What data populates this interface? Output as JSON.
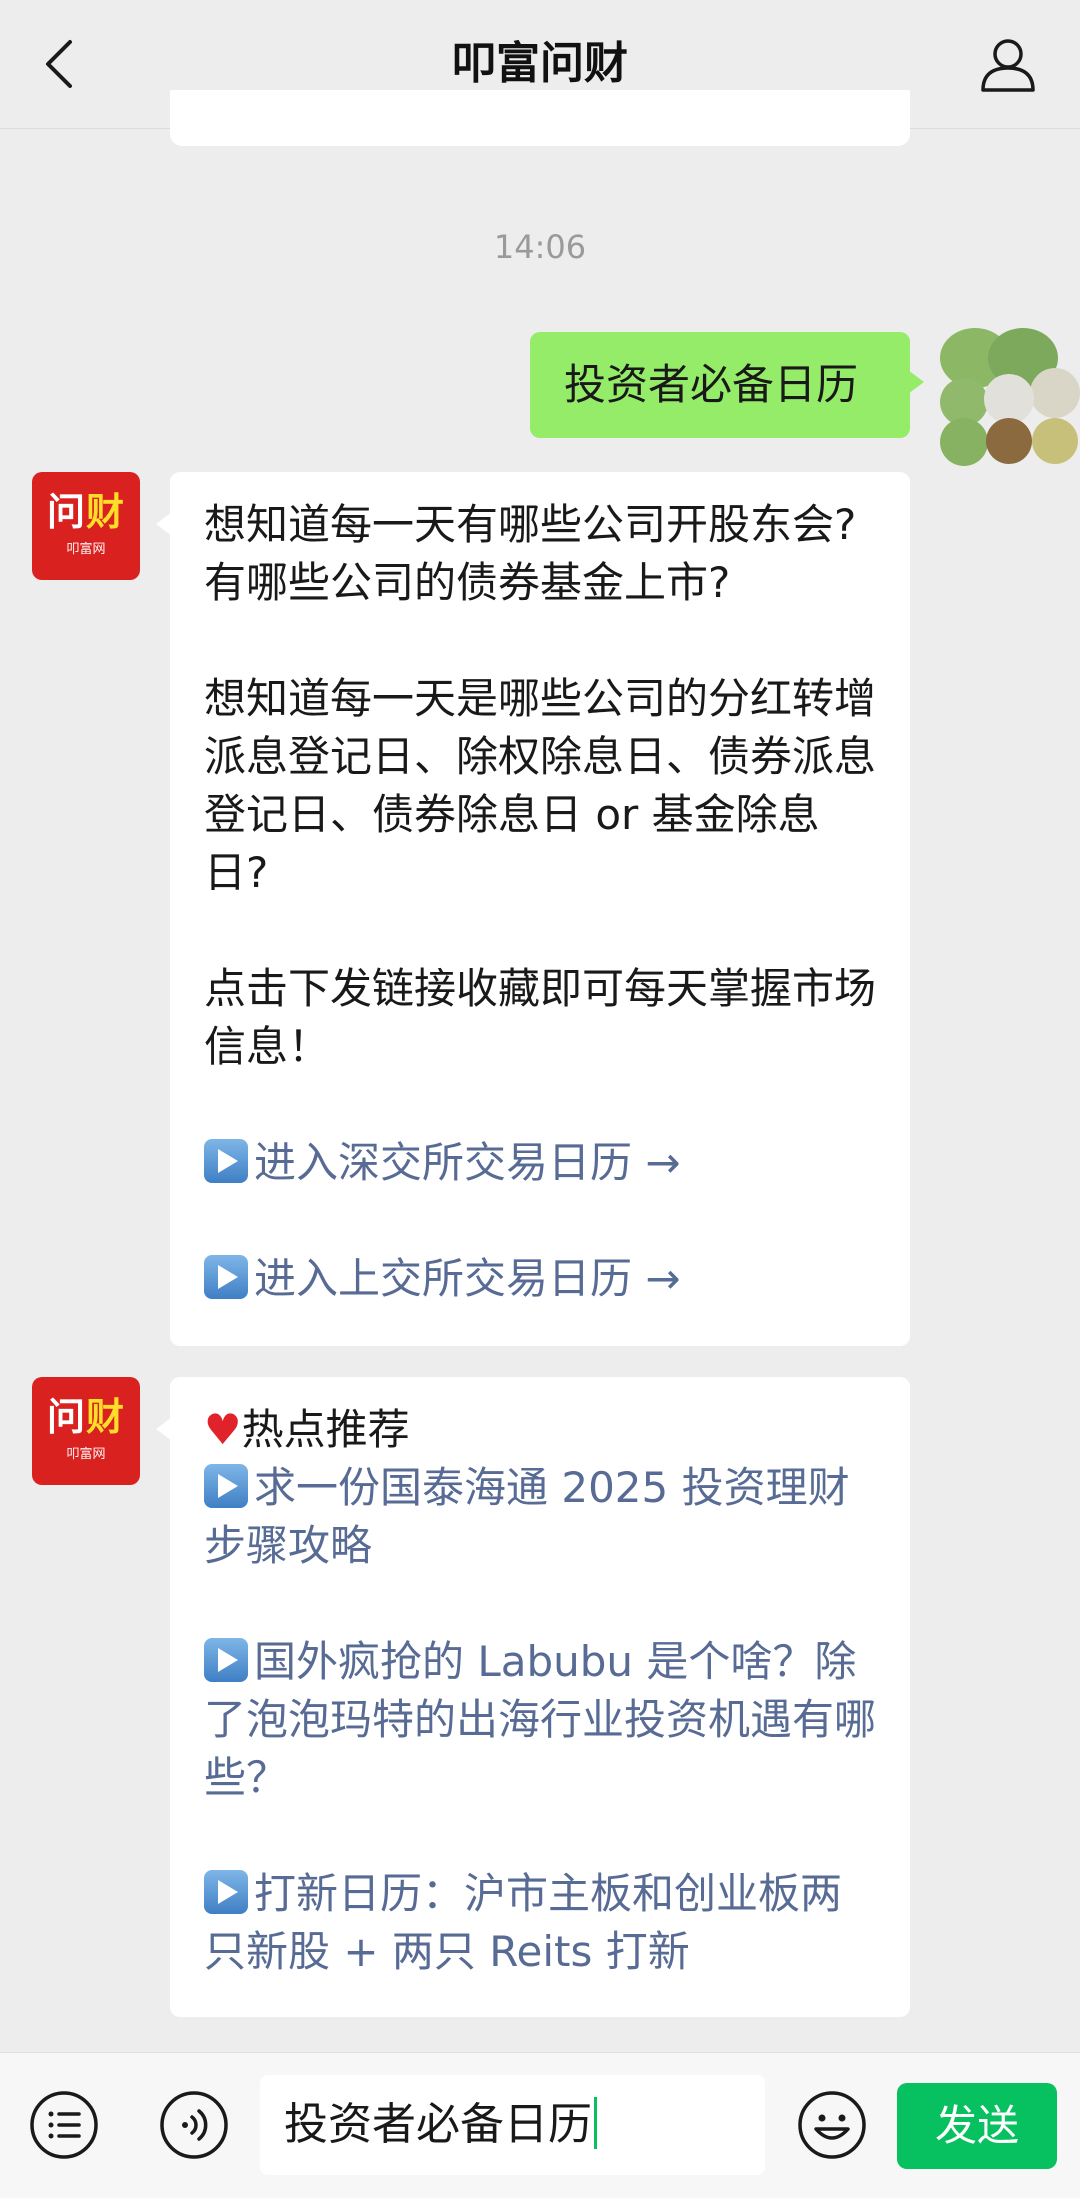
{
  "header": {
    "title": "叩富问财"
  },
  "timestamp": "14:06",
  "bot_avatar": {
    "big_text_1": "问",
    "big_text_2": "财",
    "small_text": "叩富网"
  },
  "messages": {
    "user_1": "投资者必备日历",
    "bot_1": {
      "p1": "想知道每一天有哪些公司开股东会?有哪些公司的债券基金上市?",
      "p2": "想知道每一天是哪些公司的分红转增派息登记日、除权除息日、债券派息登记日、债券除息日 or 基金除息日?",
      "p3": "点击下发链接收藏即可每天掌握市场信息！",
      "link1": "进入深交所交易日历 →",
      "link2": "进入上交所交易日历 →"
    },
    "bot_2": {
      "heading": "热点推荐",
      "link1": "求一份国泰海通 2025 投资理财步骤攻略",
      "link2": "国外疯抢的 Labubu 是个啥？除了泡泡玛特的出海行业投资机遇有哪些？",
      "link3": "打新日历：沪市主板和创业板两只新股 + 两只 Reits 打新"
    }
  },
  "input_bar": {
    "value": "投资者必备日历",
    "send_label": "发送"
  },
  "colors": {
    "accent": "#07c160",
    "user_bubble": "#95ec69",
    "link": "#576b95",
    "bot_avatar": "#d9221f"
  }
}
